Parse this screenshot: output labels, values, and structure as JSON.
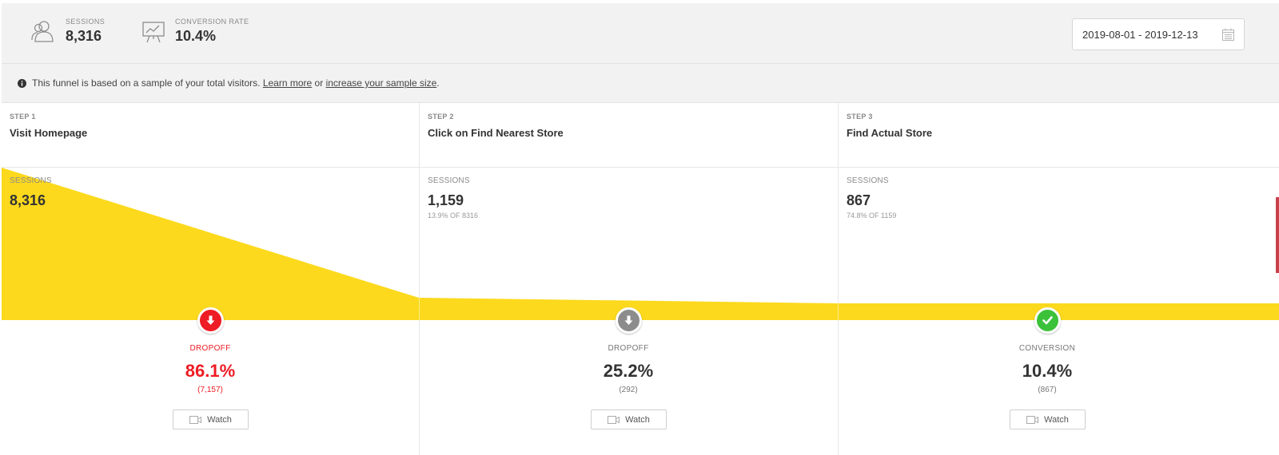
{
  "header": {
    "sessions": {
      "label": "SESSIONS",
      "value": "8,316",
      "icon": "users-icon"
    },
    "conversion_rate": {
      "label": "CONVERSION RATE",
      "value": "10.4%",
      "icon": "presentation-chart-icon"
    },
    "date_range": {
      "value": "2019-08-01 - 2019-12-13",
      "icon": "calendar-icon"
    }
  },
  "notice": {
    "text": "This funnel is based on a sample of your total visitors.",
    "learn_more": "Learn more",
    "or": "or",
    "increase_link": "increase your sample size",
    "end": "."
  },
  "colors": {
    "funnel_fill": "#fcd91d",
    "dropoff_red": "#ee1c24",
    "neutral_grey": "#8c8c8c",
    "conversion_green": "#3cc13b"
  },
  "steps": [
    {
      "step_label": "STEP 1",
      "name": "Visit Homepage",
      "sessions_label": "SESSIONS",
      "sessions": "8,316",
      "sessions_sub": "",
      "result_label": "DROPOFF",
      "result_value": "86.1%",
      "result_sub": "(7,157)",
      "result_icon": "arrow-down-icon",
      "watch_label": "Watch"
    },
    {
      "step_label": "STEP 2",
      "name": "Click on Find Nearest Store",
      "sessions_label": "SESSIONS",
      "sessions": "1,159",
      "sessions_sub": "13.9% OF 8316",
      "result_label": "DROPOFF",
      "result_value": "25.2%",
      "result_sub": "(292)",
      "result_icon": "arrow-down-icon",
      "watch_label": "Watch"
    },
    {
      "step_label": "STEP 3",
      "name": "Find Actual Store",
      "sessions_label": "SESSIONS",
      "sessions": "867",
      "sessions_sub": "74.8% OF 1159",
      "result_label": "CONVERSION",
      "result_value": "10.4%",
      "result_sub": "(867)",
      "result_icon": "check-icon",
      "watch_label": "Watch"
    }
  ]
}
